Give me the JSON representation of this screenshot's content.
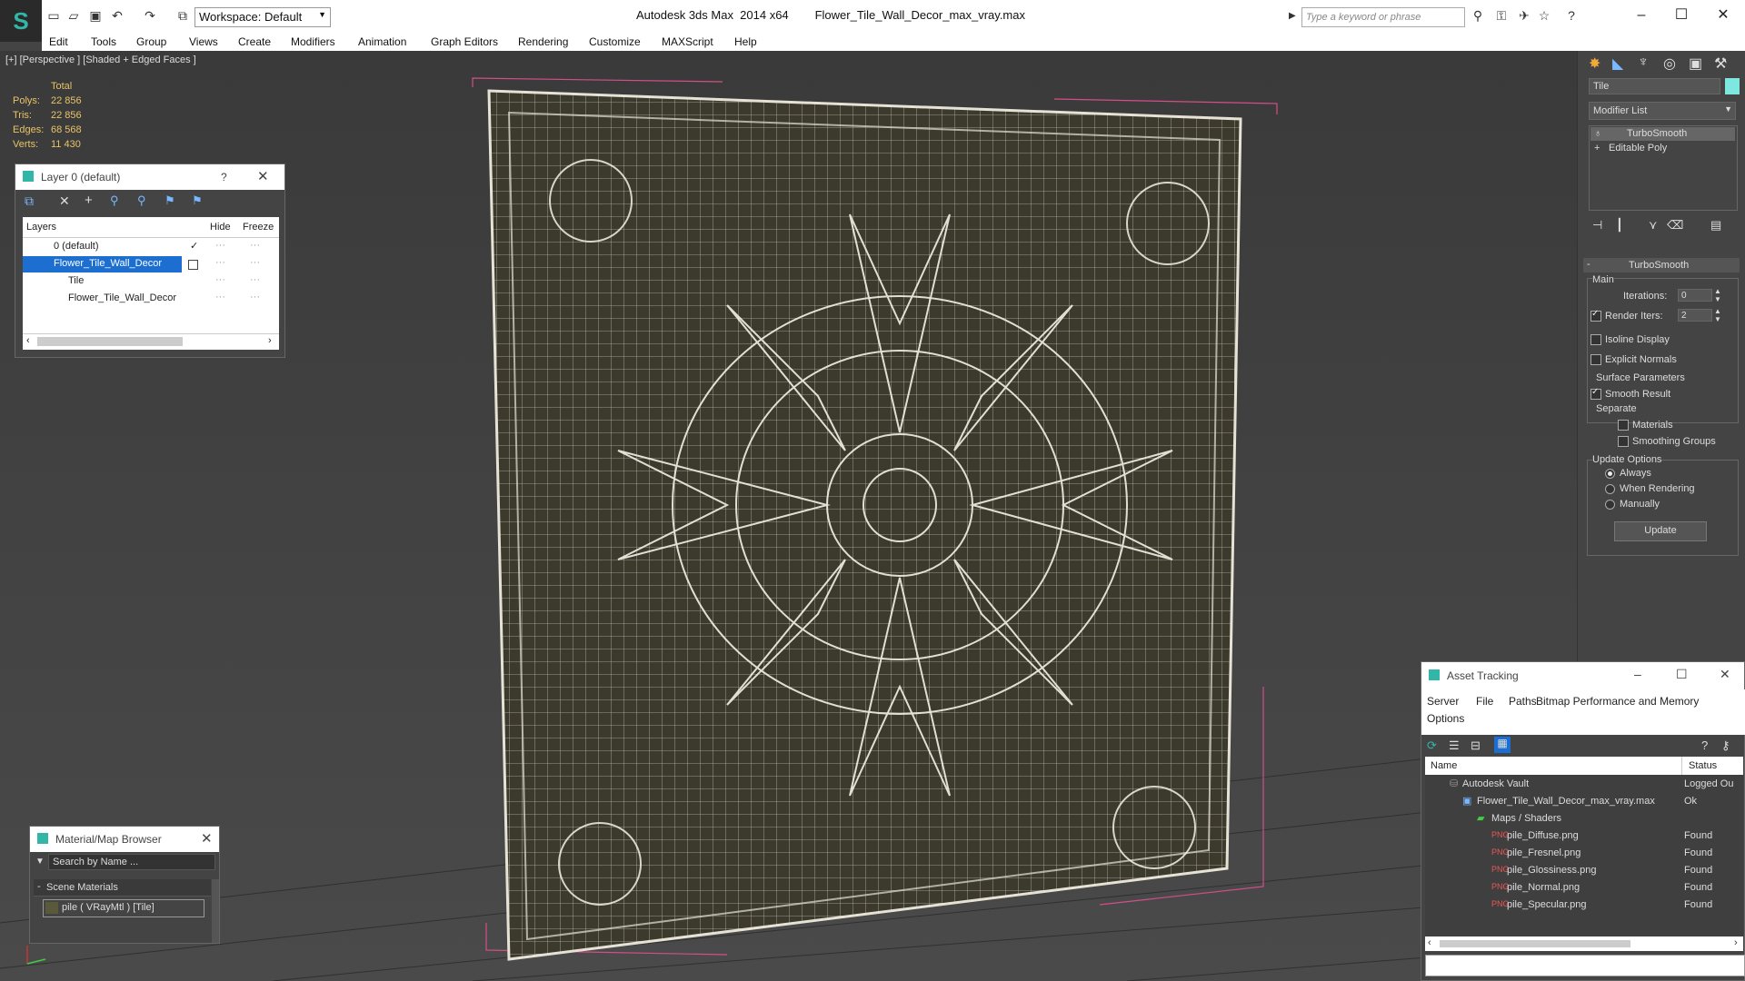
{
  "app": {
    "title": "Autodesk 3ds Max  2014 x64",
    "file": "Flower_Tile_Wall_Decor_max_vray.max",
    "workspace": "Workspace: Default",
    "search_placeholder": "Type a keyword or phrase"
  },
  "menu": [
    "Edit",
    "Tools",
    "Group",
    "Views",
    "Create",
    "Modifiers",
    "Animation",
    "Graph Editors",
    "Rendering",
    "Customize",
    "MAXScript",
    "Help"
  ],
  "viewport": {
    "label": "[+] [Perspective ] [Shaded + Edged Faces ]",
    "stats": {
      "header": "Total",
      "rows": [
        {
          "label": "Polys:",
          "value": "22 856"
        },
        {
          "label": "Tris:",
          "value": "22 856"
        },
        {
          "label": "Edges:",
          "value": "68 568"
        },
        {
          "label": "Verts:",
          "value": "11 430"
        }
      ]
    }
  },
  "layer_window": {
    "title": "Layer 0 (default)",
    "help": "?",
    "columns": [
      "Layers",
      "Hide",
      "Freeze"
    ],
    "rows": [
      {
        "name": "0 (default)",
        "checked": true,
        "selected": false
      },
      {
        "name": "Flower_Tile_Wall_Decor",
        "checked": false,
        "selected": true
      },
      {
        "name": "Tile",
        "checked": false,
        "selected": false
      },
      {
        "name": "Flower_Tile_Wall_Decor",
        "checked": false,
        "selected": false
      }
    ]
  },
  "material_browser": {
    "title": "Material/Map Browser",
    "search_placeholder": "Search by Name ...",
    "section": "Scene Materials",
    "item": "pile  ( VRayMtl ) [Tile]"
  },
  "command_panel": {
    "object_name": "Tile",
    "modifier_list": "Modifier List",
    "stack": [
      "TurboSmooth",
      "Editable Poly"
    ],
    "rollout_title": "TurboSmooth",
    "main": {
      "group": "Main",
      "iterations_label": "Iterations:",
      "iterations_value": "0",
      "render_iters_label": "Render Iters:",
      "render_iters_value": "2",
      "render_iters_checked": true,
      "isoline": "Isoline Display",
      "explicit_normals": "Explicit Normals"
    },
    "surface": {
      "group": "Surface Parameters",
      "smooth_result": "Smooth Result",
      "separate": "Separate",
      "materials": "Materials",
      "smoothing_groups": "Smoothing Groups"
    },
    "update": {
      "group": "Update Options",
      "options": [
        "Always",
        "When Rendering",
        "Manually"
      ],
      "selected": "Always",
      "button": "Update"
    }
  },
  "asset_tracking": {
    "title": "Asset Tracking",
    "menu": [
      "Server",
      "File",
      "Paths",
      "Bitmap Performance and Memory"
    ],
    "menu2": "Options",
    "columns": [
      "Name",
      "Status"
    ],
    "rows": [
      {
        "name": "Autodesk Vault",
        "status": "Logged Ou"
      },
      {
        "name": "Flower_Tile_Wall_Decor_max_vray.max",
        "status": "Ok"
      },
      {
        "name": "Maps / Shaders",
        "status": ""
      },
      {
        "name": "pile_Diffuse.png",
        "status": "Found"
      },
      {
        "name": "pile_Fresnel.png",
        "status": "Found"
      },
      {
        "name": "pile_Glossiness.png",
        "status": "Found"
      },
      {
        "name": "pile_Normal.png",
        "status": "Found"
      },
      {
        "name": "pile_Specular.png",
        "status": "Found"
      }
    ]
  },
  "colors": {
    "accent": "#31b6a8",
    "selection": "#1c6fd1",
    "stats": "#e8c36a",
    "wire": "#e6e2d6",
    "surface": "#3b3a2c"
  }
}
